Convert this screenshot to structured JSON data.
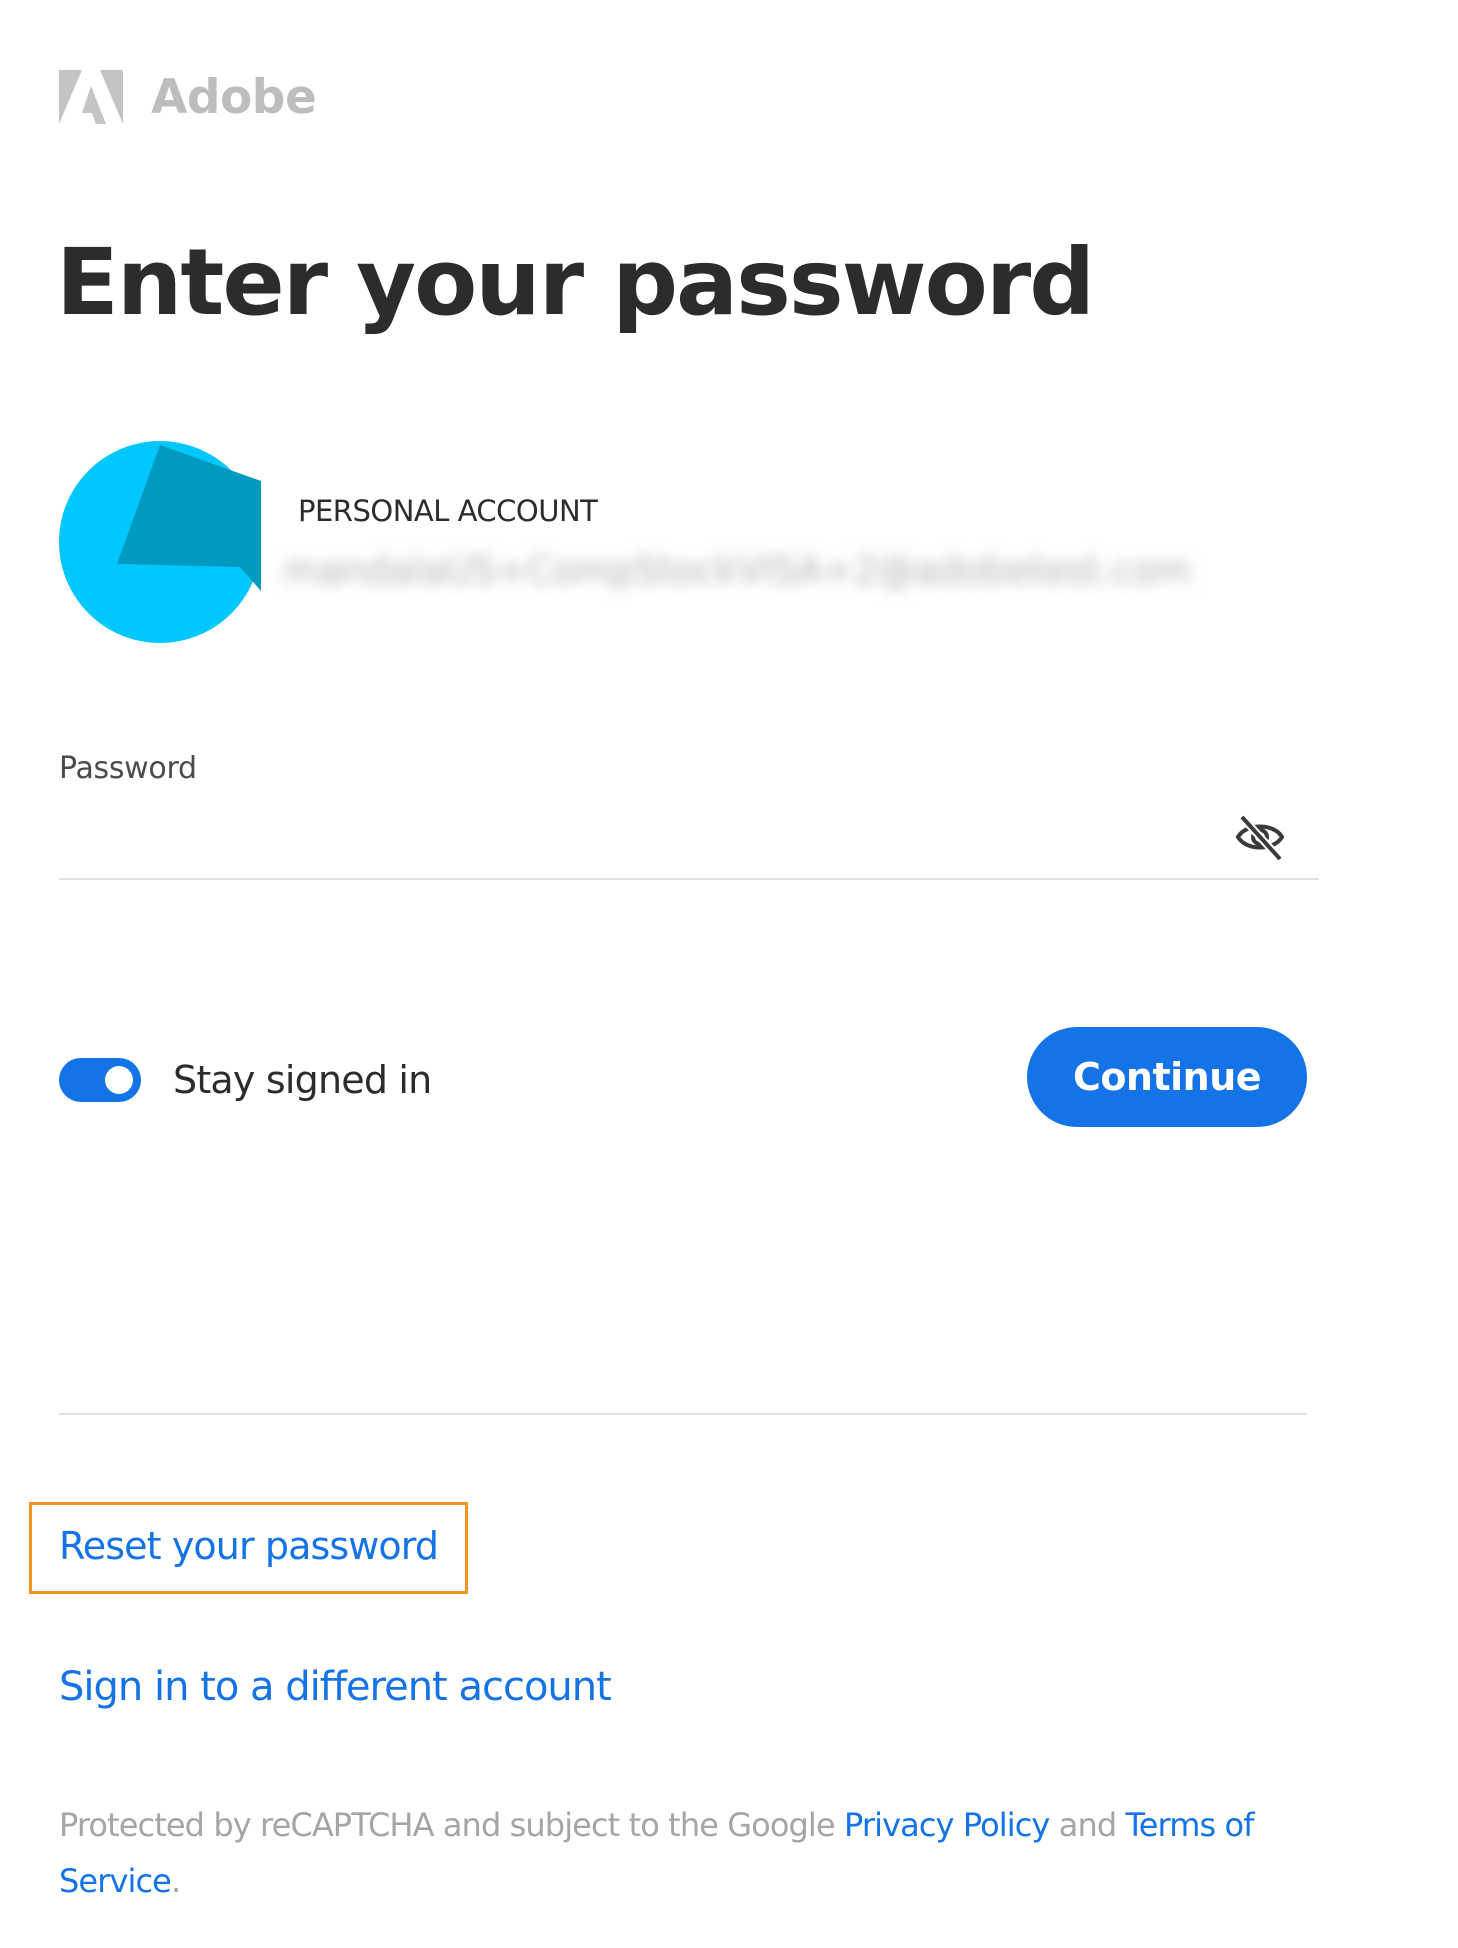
{
  "brand": {
    "name": "Adobe",
    "logo_icon": "adobe-logo-icon",
    "color": "#bdbdbd"
  },
  "page": {
    "title": "Enter your password"
  },
  "account": {
    "type_label": "PERSONAL ACCOUNT",
    "email": "mandalaUS+CompStockVISA+2@adobetest.com",
    "avatar_icon": "avatar-icon",
    "avatar_colors": [
      "#00c8ff",
      "#0099c0"
    ]
  },
  "password_field": {
    "label": "Password",
    "value": "",
    "visibility_icon": "eye-slash-icon"
  },
  "stay_signed_in": {
    "label": "Stay signed in",
    "checked": true
  },
  "actions": {
    "continue_label": "Continue"
  },
  "links": {
    "reset_password": "Reset your password",
    "different_account": "Sign in to a different account"
  },
  "footer": {
    "prefix": "Protected by reCAPTCHA and subject to the Google ",
    "privacy_policy": "Privacy Policy",
    "and": " and ",
    "terms": "Terms of Service",
    "suffix": "."
  },
  "colors": {
    "accent": "#1473e6",
    "highlight": "#f29423",
    "text": "#2c2c2c",
    "muted": "#a5a5a5"
  }
}
